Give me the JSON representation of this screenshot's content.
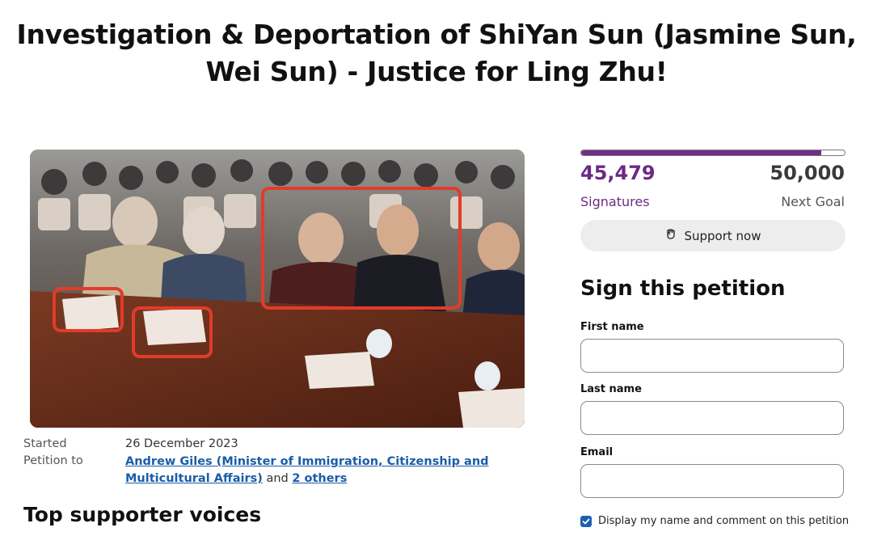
{
  "title": {
    "line1": "Investigation & Deportation of ShiYan Sun (Jasmine Sun,",
    "line2": "Wei Sun) - Justice for Ling Zhu!"
  },
  "meta": {
    "started_label": "Started",
    "started_value": "26 December 2023",
    "petition_to_label": "Petition to",
    "recipient_link_line1": "Andrew Giles (Minister of Immigration, Citizenship and",
    "recipient_link_line2": "Multicultural Affairs)",
    "and_text": "and",
    "others_link": "2 others"
  },
  "voices_heading": "Top supporter voices",
  "progress": {
    "signatures": "45,479",
    "signatures_label": "Signatures",
    "goal": "50,000",
    "goal_label": "Next Goal",
    "fraction": 0.9096
  },
  "support_button": {
    "label": "Support now",
    "icon": "raised-fist-icon"
  },
  "sign_form": {
    "heading": "Sign this petition",
    "first_name_label": "First name",
    "last_name_label": "Last name",
    "email_label": "Email",
    "first_name_value": "",
    "last_name_value": "",
    "email_value": "",
    "display_checkbox_label": "Display my name and comment on this petition",
    "display_checked": true
  },
  "colors": {
    "accent": "#702d8a",
    "link": "#1a5da8",
    "checkbox": "#1d5fb0"
  }
}
